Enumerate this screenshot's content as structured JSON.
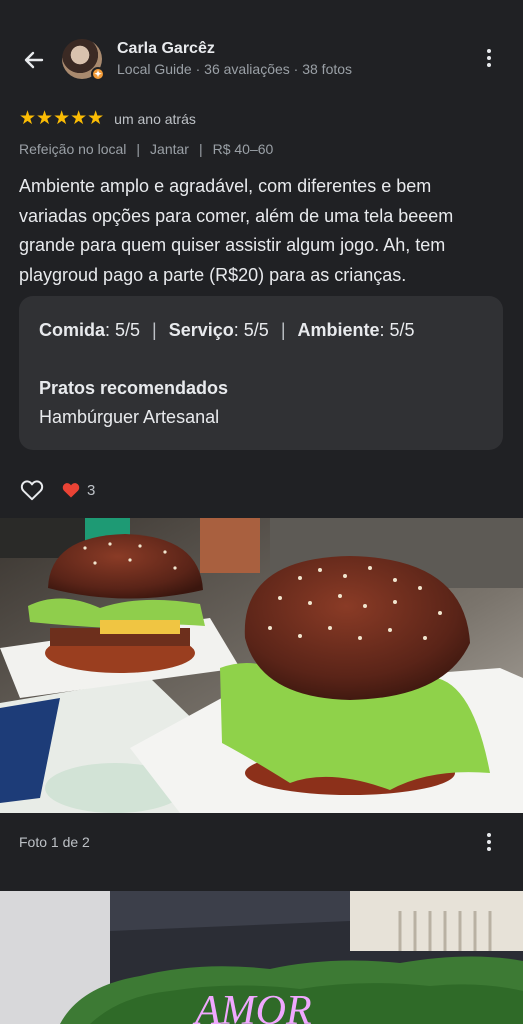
{
  "header": {
    "reviewer_name": "Carla Garcêz",
    "reviewer_meta": "Local Guide · 36 avaliações · 38 fotos",
    "back_icon": "arrow-left-icon",
    "more_icon": "more-vert-icon"
  },
  "review": {
    "stars": "★★★★★",
    "when": "um ano atrás",
    "tags": [
      "Refeição no local",
      "Jantar",
      "R$ 40–60"
    ],
    "text": "Ambiente amplo e agradável, com diferentes e bem variadas opções para comer, além de uma tela beeem grande para quem quiser assistir algum jogo. Ah, tem playgroud pago a parte (R$20) para as crianças.",
    "scores": [
      {
        "label": "Comida",
        "value": ": 5/5"
      },
      {
        "label": "Serviço",
        "value": ": 5/5"
      },
      {
        "label": "Ambiente",
        "value": ": 5/5"
      }
    ],
    "recommended_title": "Pratos recomendados",
    "recommended_value": "Hambúrguer Artesanal"
  },
  "reactions": {
    "count": "3"
  },
  "photos": {
    "caption": "Foto 1 de 2",
    "neon_text": "AMOR"
  },
  "colors": {
    "background": "#202124",
    "card": "#303134",
    "star": "#fbbc04",
    "heart": "#ea4335"
  }
}
